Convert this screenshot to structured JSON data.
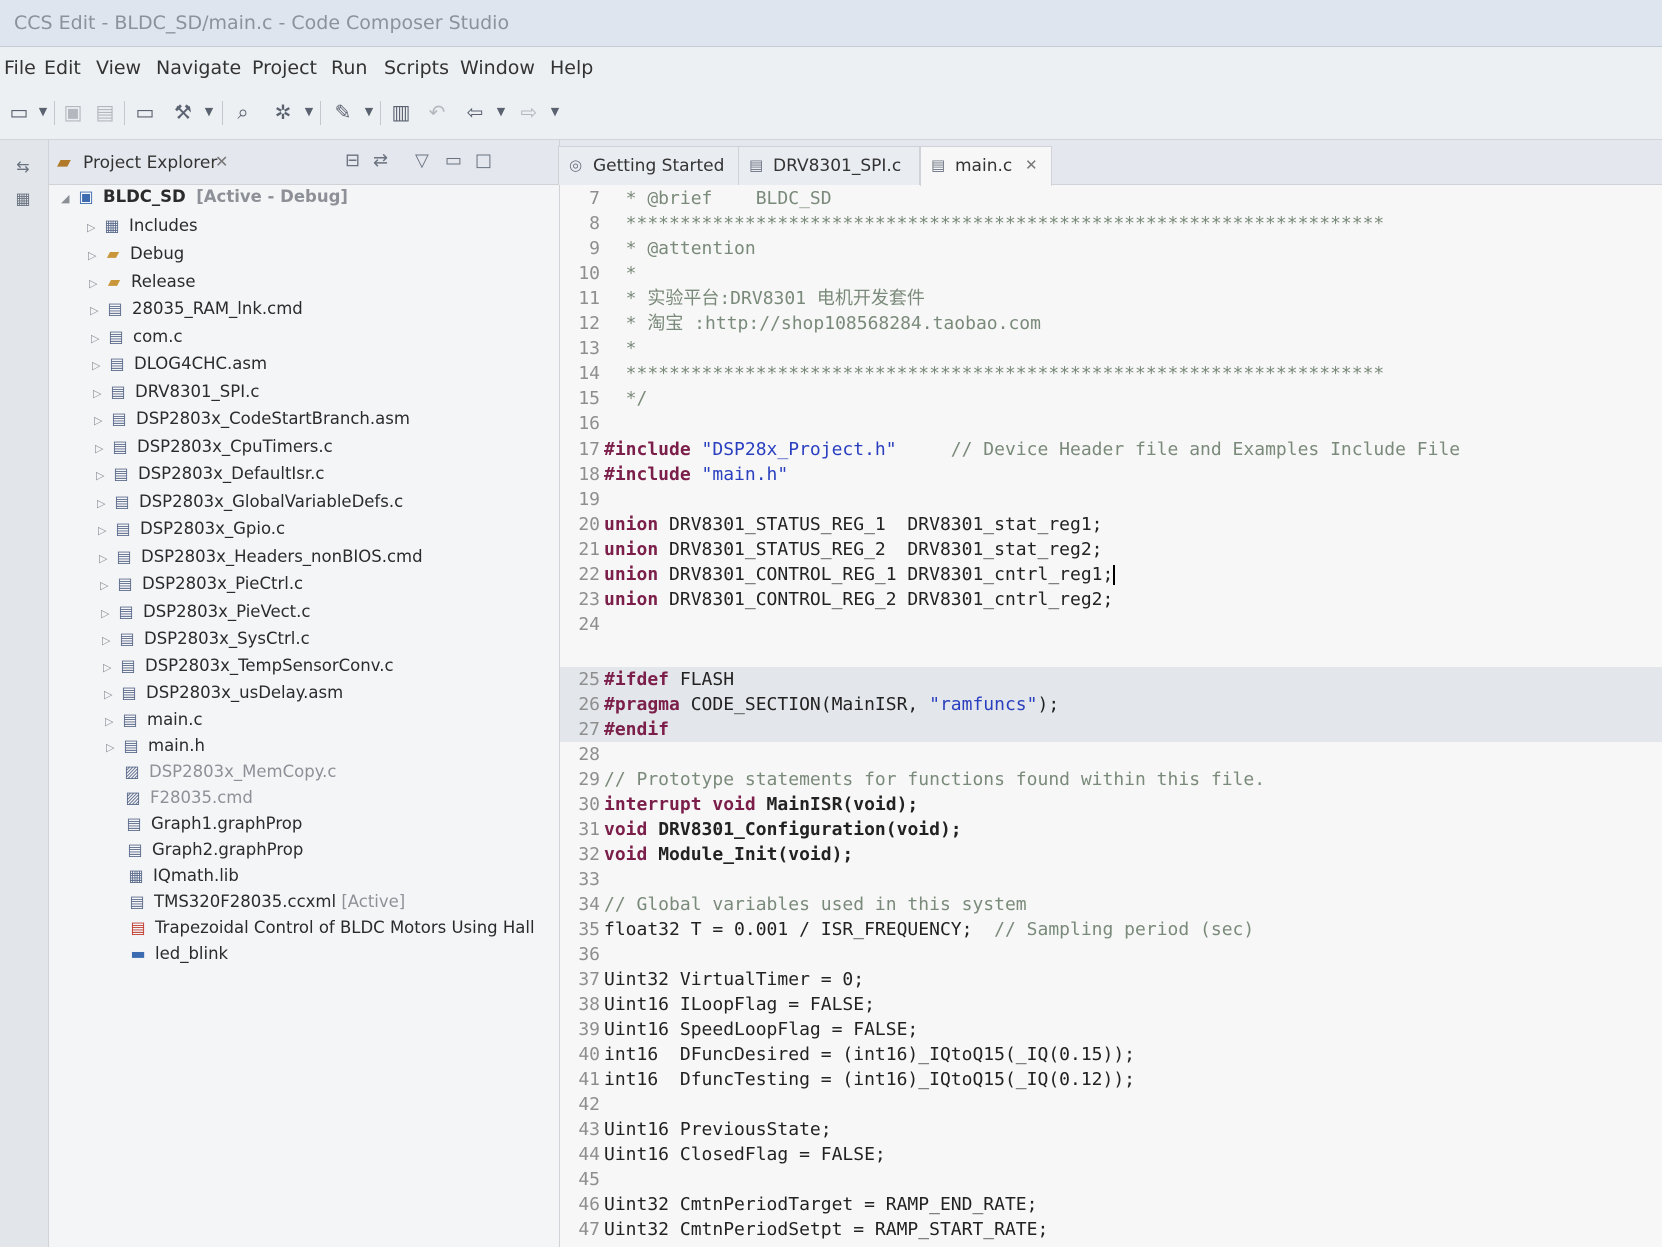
{
  "window": {
    "title": "CCS Edit - BLDC_SD/main.c - Code Composer Studio"
  },
  "menu": [
    "File",
    "Edit",
    "View",
    "Navigate",
    "Project",
    "Run",
    "Scripts",
    "Window",
    "Help"
  ],
  "project_explorer": {
    "title": "Project Explorer",
    "root": {
      "name": "BLDC_SD",
      "tag": "[Active - Debug]"
    },
    "items": [
      "Includes",
      "Debug",
      "Release",
      "28035_RAM_lnk.cmd",
      "com.c",
      "DLOG4CHC.asm",
      "DRV8301_SPI.c",
      "DSP2803x_CodeStartBranch.asm",
      "DSP2803x_CpuTimers.c",
      "DSP2803x_DefaultIsr.c",
      "DSP2803x_GlobalVariableDefs.c",
      "DSP2803x_Gpio.c",
      "DSP2803x_Headers_nonBIOS.cmd",
      "DSP2803x_PieCtrl.c",
      "DSP2803x_PieVect.c",
      "DSP2803x_SysCtrl.c",
      "DSP2803x_TempSensorConv.c",
      "DSP2803x_usDelay.asm",
      "main.c",
      "main.h",
      "DSP2803x_MemCopy.c",
      "F28035.cmd",
      "Graph1.graphProp",
      "Graph2.graphProp",
      "IQmath.lib",
      "TMS320F28035.ccxml",
      "Trapezoidal Control of BLDC Motors Using Hall"
    ],
    "active_tag": "[Active]",
    "other_project": "led_blink"
  },
  "editor": {
    "tabs": [
      "Getting Started",
      "DRV8301_SPI.c",
      "main.c"
    ],
    "lines": [
      {
        "n": "7",
        "t": "  * @brief    BLDC_SD"
      },
      {
        "n": "8",
        "t": "  **********************************************************************"
      },
      {
        "n": "9",
        "t": "  * @attention"
      },
      {
        "n": "10",
        "t": "  *"
      },
      {
        "n": "11",
        "t": "  * 实验平台:DRV8301 电机开发套件"
      },
      {
        "n": "12",
        "t": "  * 淘宝 :http://shop108568284.taobao.com"
      },
      {
        "n": "13",
        "t": "  *"
      },
      {
        "n": "14",
        "t": "  **********************************************************************"
      },
      {
        "n": "15",
        "t": "  */"
      },
      {
        "n": "16",
        "t": ""
      },
      {
        "n": "17",
        "a": "#include",
        "b": " \"DSP28x_Project.h\"",
        "c": "     // Device Header file and Examples Include File"
      },
      {
        "n": "18",
        "a": "#include",
        "b": " \"main.h\""
      },
      {
        "n": "19",
        "t": ""
      },
      {
        "n": "20",
        "a": "union",
        "t2": " DRV8301_STATUS_REG_1  DRV8301_stat_reg1;"
      },
      {
        "n": "21",
        "a": "union",
        "t2": " DRV8301_STATUS_REG_2  DRV8301_stat_reg2;"
      },
      {
        "n": "22",
        "a": "union",
        "t2": " DRV8301_CONTROL_REG_1 DRV8301_cntrl_reg1;"
      },
      {
        "n": "23",
        "a": "union",
        "t2": " DRV8301_CONTROL_REG_2 DRV8301_cntrl_reg2;"
      },
      {
        "n": "24",
        "t": ""
      },
      {
        "n": "25",
        "a": "#ifdef",
        "t2": " FLASH"
      },
      {
        "n": "26",
        "a": "#pragma",
        "t2": " CODE_SECTION(MainISR, ",
        "b": "\"ramfuncs\"",
        "t3": ");"
      },
      {
        "n": "27",
        "a": "#endif"
      },
      {
        "n": "28",
        "t": ""
      },
      {
        "n": "29",
        "t": "// Prototype statements for functions found within this file."
      },
      {
        "n": "30",
        "a": "interrupt void",
        "t2": " MainISR(void);"
      },
      {
        "n": "31",
        "a": "void",
        "t2": " DRV8301_Configuration(void);"
      },
      {
        "n": "32",
        "a": "void",
        "t2": " Module_Init(void);"
      },
      {
        "n": "33",
        "t": ""
      },
      {
        "n": "34",
        "t": "// Global variables used in this system"
      },
      {
        "n": "35",
        "t2": "float32 T = 0.001 / ISR_FREQUENCY;",
        "c": "  // Sampling period (sec)"
      },
      {
        "n": "36",
        "t": ""
      },
      {
        "n": "37",
        "t2": "Uint32 VirtualTimer = 0;"
      },
      {
        "n": "38",
        "t2": "Uint16 ILoopFlag = FALSE;"
      },
      {
        "n": "39",
        "t2": "Uint16 SpeedLoopFlag = FALSE;"
      },
      {
        "n": "40",
        "t2": "int16  DFuncDesired = (int16)_IQtoQ15(_IQ(0.15));"
      },
      {
        "n": "41",
        "t2": "int16  DfuncTesting = (int16)_IQtoQ15(_IQ(0.12));"
      },
      {
        "n": "42",
        "t": ""
      },
      {
        "n": "43",
        "t2": "Uint16 PreviousState;"
      },
      {
        "n": "44",
        "t2": "Uint16 ClosedFlag = FALSE;"
      },
      {
        "n": "45",
        "t": ""
      },
      {
        "n": "46",
        "t2": "Uint32 CmtnPeriodTarget = RAMP_END_RATE;"
      },
      {
        "n": "47",
        "t2": "Uint32 CmtnPeriodSetpt = RAMP_START_RATE;"
      }
    ]
  }
}
